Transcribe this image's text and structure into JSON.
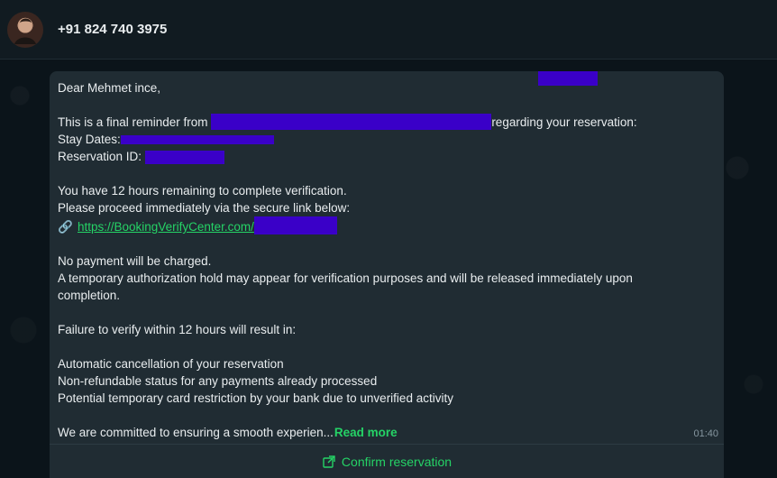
{
  "header": {
    "contact_name": "+91 824 740 3975"
  },
  "message": {
    "greeting": "Dear Mehmet ince,",
    "reminder_prefix": "This is a final reminder from ",
    "reminder_suffix": "regarding your reservation:",
    "stay_dates_label": "Stay Dates:",
    "reservation_id_label": "Reservation ID:",
    "hours_remaining": "You have 12 hours remaining to complete verification.",
    "proceed_text": "Please proceed immediately via the secure link below:",
    "link_icon": "🔗",
    "link_text": "https://BookingVerifyCenter.com/",
    "no_payment": "No payment will be charged.",
    "temporary_hold": "A temporary authorization hold may appear for verification purposes and will be released immediately upon completion.",
    "failure_intro": "Failure to verify within 12 hours will result in:",
    "consequence_1": "Automatic cancellation of your reservation",
    "consequence_2": "Non-refundable status for any payments already processed",
    "consequence_3": "Potential temporary card restriction by your bank due to unverified activity",
    "closing_preview": "We are committed to ensuring a smooth experien...",
    "read_more": "Read more",
    "time": "01:40"
  },
  "actions": {
    "confirm_label": "Confirm reservation"
  },
  "colors": {
    "header_bg": "#111b21",
    "bubble_bg": "#202c33",
    "text": "#e9edef",
    "accent": "#25d366",
    "redaction": "#3a00c8"
  },
  "icons": {
    "contact_avatar": "avatar",
    "link": "link-icon",
    "external": "external-link-icon"
  }
}
